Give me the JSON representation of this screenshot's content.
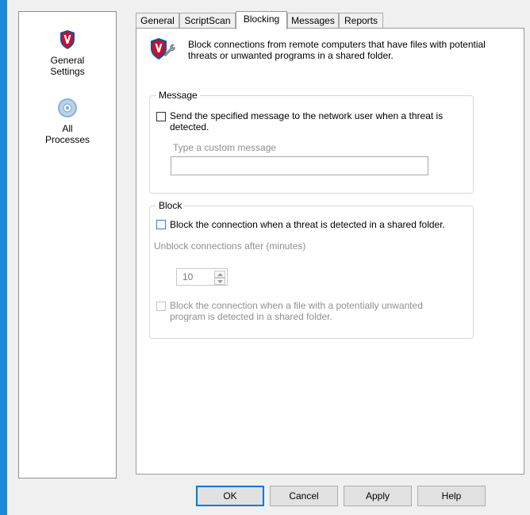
{
  "sidebar": {
    "items": [
      {
        "label": "General\nSettings",
        "icon": "shield-icon"
      },
      {
        "label": "All\nProcesses",
        "icon": "disc-icon"
      }
    ]
  },
  "tabs": [
    {
      "label": "General"
    },
    {
      "label": "ScriptScan"
    },
    {
      "label": "Blocking",
      "active": true
    },
    {
      "label": "Messages"
    },
    {
      "label": "Reports"
    }
  ],
  "header": {
    "description": "Block connections from remote computers that have files with potential threats or unwanted programs in a shared folder."
  },
  "message_group": {
    "title": "Message",
    "send_message_label": "Send the specified message to the network user when a threat is detected.",
    "custom_message_label": "Type a custom message",
    "custom_message_value": ""
  },
  "block_group": {
    "title": "Block",
    "block_threat_label": "Block the connection when a threat is detected in a shared folder.",
    "unblock_after_label": "Unblock connections after (minutes)",
    "unblock_minutes": "10",
    "block_pup_label": "Block the connection when a file with a potentially unwanted program is detected in a shared folder."
  },
  "buttons": {
    "ok": "OK",
    "cancel": "Cancel",
    "apply": "Apply",
    "help": "Help"
  },
  "colors": {
    "accent": "#1c8ad8",
    "shield_red": "#c8102e",
    "shield_blue": "#1b4d9c"
  }
}
